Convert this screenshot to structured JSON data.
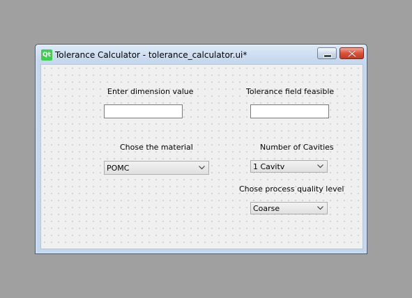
{
  "window": {
    "title": "Tolerance Calculator - tolerance_calculator.ui*",
    "logo_text": "Qt"
  },
  "form": {
    "dimension_label": "Enter dimension value",
    "dimension_value": "",
    "tolerance_label": "Tolerance field feasible",
    "tolerance_value": "",
    "material_label": "Chose the material",
    "material_selected": "POMC",
    "cavities_label": "Number of Cavities",
    "cavities_selected": "1 Cavitv",
    "quality_label": "Chose process quality level",
    "quality_selected": "Coarse"
  },
  "icons": {
    "minimize": "minimize-icon",
    "close": "close-icon",
    "dropdown": "chevron-down-icon",
    "logo": "qt-logo-icon"
  },
  "colors": {
    "titlebar": "#c6d8ee",
    "close_button": "#c43a24",
    "canvas": "#f0f0f0",
    "desktop": "#a0a0a0"
  }
}
